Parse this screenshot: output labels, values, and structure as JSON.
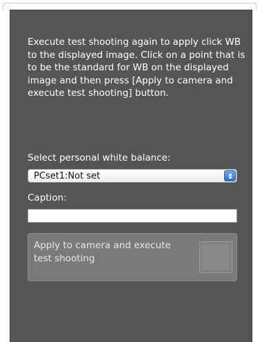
{
  "panel": {
    "instructions": "Execute test shooting again to apply click WB to the displayed image. Click on a point that is to be the standard for WB on the displayed image and then press [Apply to camera and execute test shooting] button.",
    "select_label": "Select personal white balance:",
    "select_value": "PCset1:Not set",
    "caption_label": "Caption:",
    "caption_value": "",
    "apply_button_label": "Apply to camera and execute test shooting"
  },
  "colors": {
    "panel_background": "#555555",
    "text": "#ffffff",
    "button_background": "#7a7a7a",
    "select_arrow_accent": "#2d6fd6"
  },
  "icons": {
    "select_arrows": "up-down-chevron-icon"
  }
}
